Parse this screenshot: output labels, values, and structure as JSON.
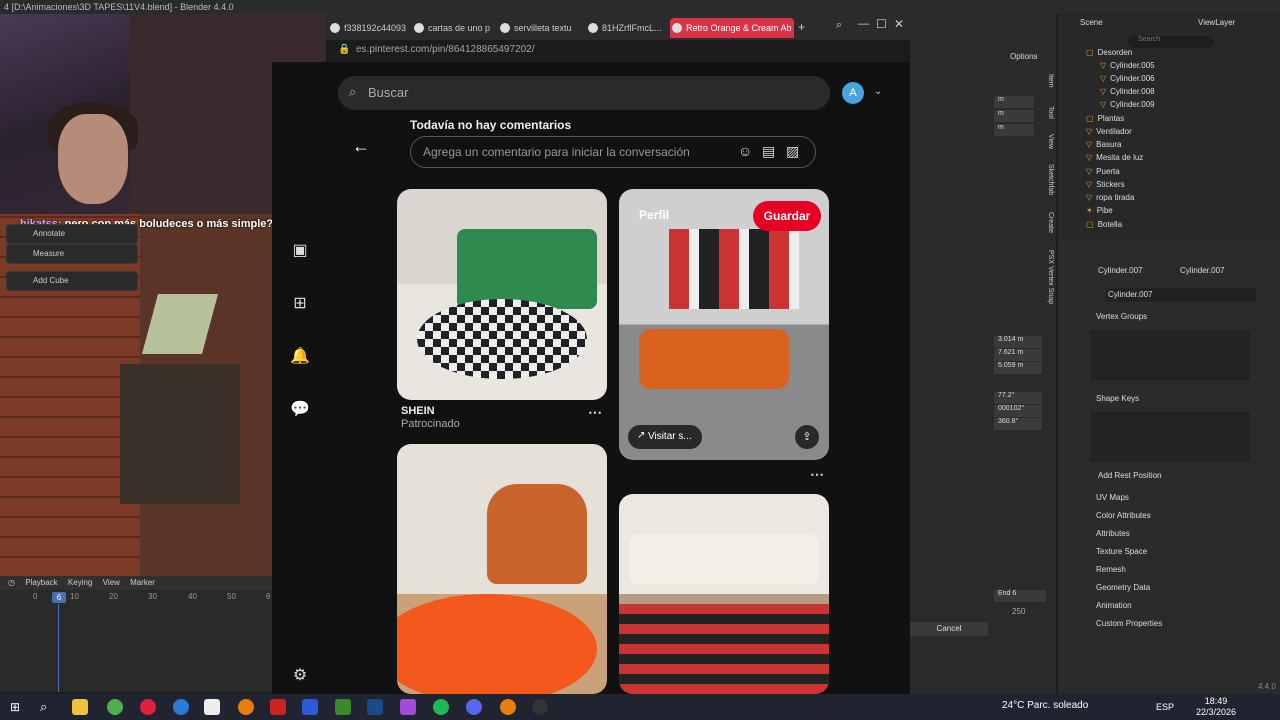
{
  "blender": {
    "title": "4 [D:\\Animaciones\\3D TAPES\\11V4.blend] - Blender 4.4.0",
    "chat_user": "hikatss:",
    "chat_text": "pero con más boludeces o más simple? onda abstracto y líneas ooo puntetes",
    "tool_annotate": "Annotate",
    "tool_measure": "Measure",
    "tool_add_cube": "Add Cube",
    "timeline": {
      "playback": "Playback",
      "keying": "Keying",
      "view": "View",
      "marker": "Marker",
      "ticks": [
        "0",
        "10",
        "20",
        "30",
        "40",
        "50",
        "6"
      ],
      "current_frame": "6",
      "end_label": "End",
      "end_value": "6",
      "frame_250": "250"
    },
    "mid_panel": {
      "options": "Options",
      "values": [
        "m",
        "m",
        "m",
        "3.014 m",
        "7.621 m",
        "5.059 m",
        "77.2°",
        "000102°",
        "360.8°"
      ],
      "cancel": "Cancel",
      "side_tabs": [
        "Item",
        "Tool",
        "View",
        "Sketchfab",
        "Create",
        "PSX Vertex Snap"
      ]
    },
    "outliner": {
      "scene": "Scene",
      "view_layer": "ViewLayer",
      "search_placeholder": "Search",
      "rows": [
        "Desorden",
        "Cylinder.005",
        "Cylinder.006",
        "Cylinder.008",
        "Cylinder.009",
        "Plantas",
        "Ventilador",
        "Basura",
        "Mesita de luz",
        "Puerta",
        "Stickers",
        "ropa tirada",
        "Pibe",
        "Botella"
      ]
    },
    "properties": {
      "breadcrumb_a": "Cylinder.007",
      "breadcrumb_b": "Cylinder.007",
      "mesh_name": "Cylinder.007",
      "vertex_groups": "Vertex Groups",
      "shape_keys": "Shape Keys",
      "add_rest_position": "Add Rest Position",
      "sections": [
        "UV Maps",
        "Color Attributes",
        "Attributes",
        "Texture Space",
        "Remesh",
        "Geometry Data",
        "Animation",
        "Custom Properties"
      ]
    },
    "version": "4.4.0"
  },
  "browser": {
    "tabs": [
      "f338192c44093",
      "cartas de uno p",
      "servilleta textu",
      "81HZrflFmcL...",
      "Retro Orange & Cream Ab"
    ],
    "active_tab_index": 4,
    "url": "es.pinterest.com/pin/864128865497202/"
  },
  "pinterest": {
    "search_placeholder": "Buscar",
    "avatar_letter": "A",
    "no_comments": "Todavía no hay comentarios",
    "comment_placeholder": "Agrega un comentario para iniciar la conversación",
    "save_button": "Guardar",
    "profile_label": "Perfil",
    "visit_label": "Visitar s...",
    "pin1_title": "SHEIN",
    "pin1_subtitle": "Patrocinado",
    "accent": "#e60023"
  },
  "taskbar": {
    "weather": "24°C  Parc. soleado",
    "lang": "ESP",
    "time": "18:49",
    "date": "22/3/2026"
  }
}
